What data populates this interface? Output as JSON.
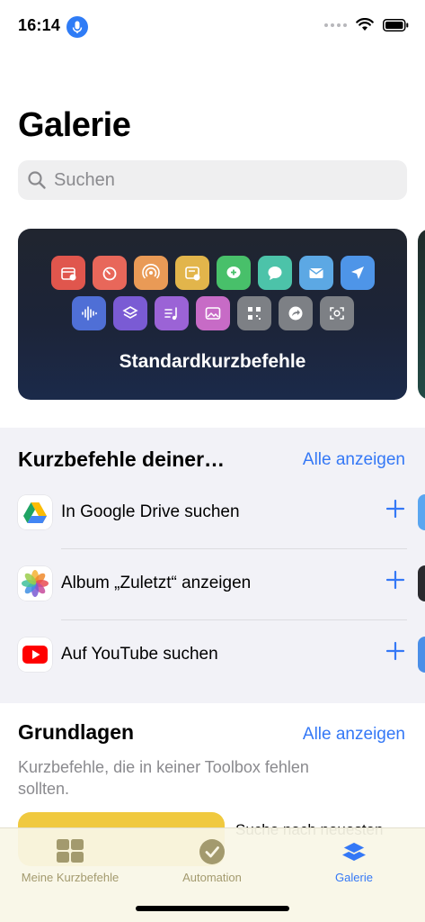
{
  "status": {
    "time": "16:14"
  },
  "page": {
    "title": "Galerie"
  },
  "search": {
    "placeholder": "Suchen"
  },
  "hero": {
    "title": "Standardkurzbefehle",
    "row1_icons": [
      {
        "name": "calendar-add-icon",
        "color": "#e0564d"
      },
      {
        "name": "timer-icon",
        "color": "#e8675a"
      },
      {
        "name": "airdrop-icon",
        "color": "#e99a56"
      },
      {
        "name": "note-add-icon",
        "color": "#e2b54b"
      },
      {
        "name": "message-add-icon",
        "color": "#48c06a"
      },
      {
        "name": "message-icon",
        "color": "#4cc3a9"
      },
      {
        "name": "mail-icon",
        "color": "#5ca8e4"
      },
      {
        "name": "send-icon",
        "color": "#4e95e8"
      }
    ],
    "row2_icons": [
      {
        "name": "soundwave-icon",
        "color": "#4f6fd6"
      },
      {
        "name": "layers-icon",
        "color": "#7a5bd4"
      },
      {
        "name": "music-list-icon",
        "color": "#9b63d6"
      },
      {
        "name": "photos-icon",
        "color": "#c76bc6"
      },
      {
        "name": "qr-code-icon",
        "color": "#7d8085"
      },
      {
        "name": "share-arrow-icon",
        "color": "#7d8085"
      },
      {
        "name": "screenshot-icon",
        "color": "#7d8085"
      }
    ]
  },
  "apps_section": {
    "title": "Kurzbefehle deiner…",
    "link": "Alle anzeigen",
    "items": [
      {
        "label": "In Google Drive suchen"
      },
      {
        "label": "Album „Zuletzt“ anzeigen"
      },
      {
        "label": "Auf YouTube suchen"
      }
    ]
  },
  "basics_section": {
    "title": "Grundlagen",
    "link": "Alle anzeigen",
    "description": "Kurzbefehle, die in keiner Toolbox fehlen sollten.",
    "peek_text": "Suche nach neuesten"
  },
  "tabbar": {
    "tabs": [
      {
        "label": "Meine Kurzbefehle",
        "active": false
      },
      {
        "label": "Automation",
        "active": false
      },
      {
        "label": "Galerie",
        "active": true
      }
    ],
    "colors": {
      "inactive": "#a39a6e",
      "active": "#3478f6"
    }
  },
  "colors": {
    "accent": "#3478f6",
    "secondary_text": "#8a8a8e"
  }
}
